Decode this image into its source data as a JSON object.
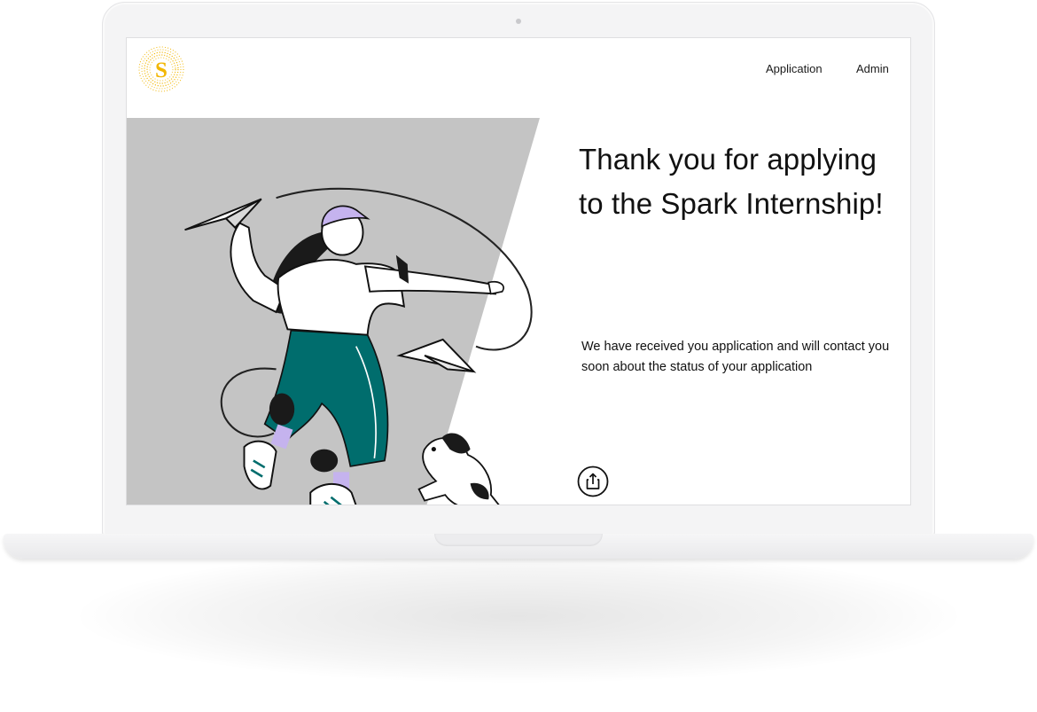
{
  "brand": {
    "logo_letter": "S",
    "accent_color": "#f2b705"
  },
  "nav": {
    "items": [
      {
        "label": "Application"
      },
      {
        "label": "Admin"
      }
    ]
  },
  "main": {
    "headline": "Thank you for applying to the Spark Internship!",
    "message": "We have received you application and will contact you soon about the status of your application",
    "share_icon": "share-icon"
  },
  "colors": {
    "panel": "#c4c4c4",
    "pants": "#006d6d",
    "cap": "#c5b3ee"
  }
}
